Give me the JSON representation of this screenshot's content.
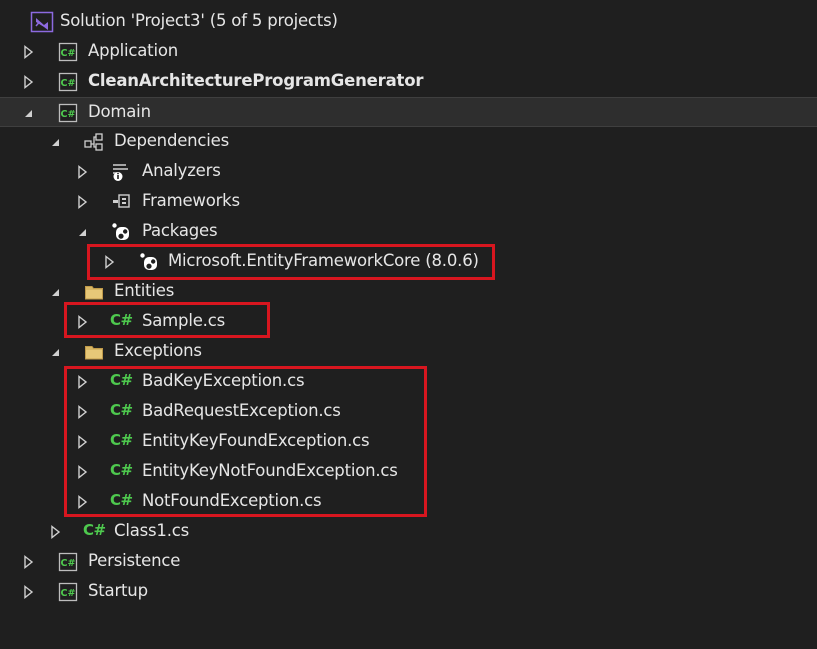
{
  "solution": {
    "label": "Solution 'Project3' (5 of 5 projects)"
  },
  "projects": {
    "application": "Application",
    "generator": "CleanArchitectureProgramGenerator",
    "domain": "Domain",
    "persistence": "Persistence",
    "startup": "Startup"
  },
  "domain": {
    "dependencies": "Dependencies",
    "analyzers": "Analyzers",
    "frameworks": "Frameworks",
    "packages": "Packages",
    "package_item": "Microsoft.EntityFrameworkCore (8.0.6)",
    "entities": "Entities",
    "sample": "Sample.cs",
    "exceptions": "Exceptions",
    "exception_files": [
      "BadKeyException.cs",
      "BadRequestException.cs",
      "EntityKeyFoundException.cs",
      "EntityKeyNotFoundException.cs",
      "NotFoundException.cs"
    ],
    "class1": "Class1.cs"
  },
  "colors": {
    "background": "#1f1f1f",
    "selected_row": "#2e2e2e",
    "highlight_border": "#d7161f",
    "csharp_green": "#4ec94e",
    "vs_purple": "#8d6ae0",
    "folder": "#d8b766"
  },
  "icons": {
    "solution": "visual-studio-solution-icon",
    "project": "csharp-project-icon",
    "file": "csharp-file-icon",
    "folder": "folder-icon",
    "dependencies": "dependencies-icon",
    "analyzers": "analyzers-icon",
    "frameworks": "frameworks-icon",
    "packages": "nuget-package-icon"
  }
}
